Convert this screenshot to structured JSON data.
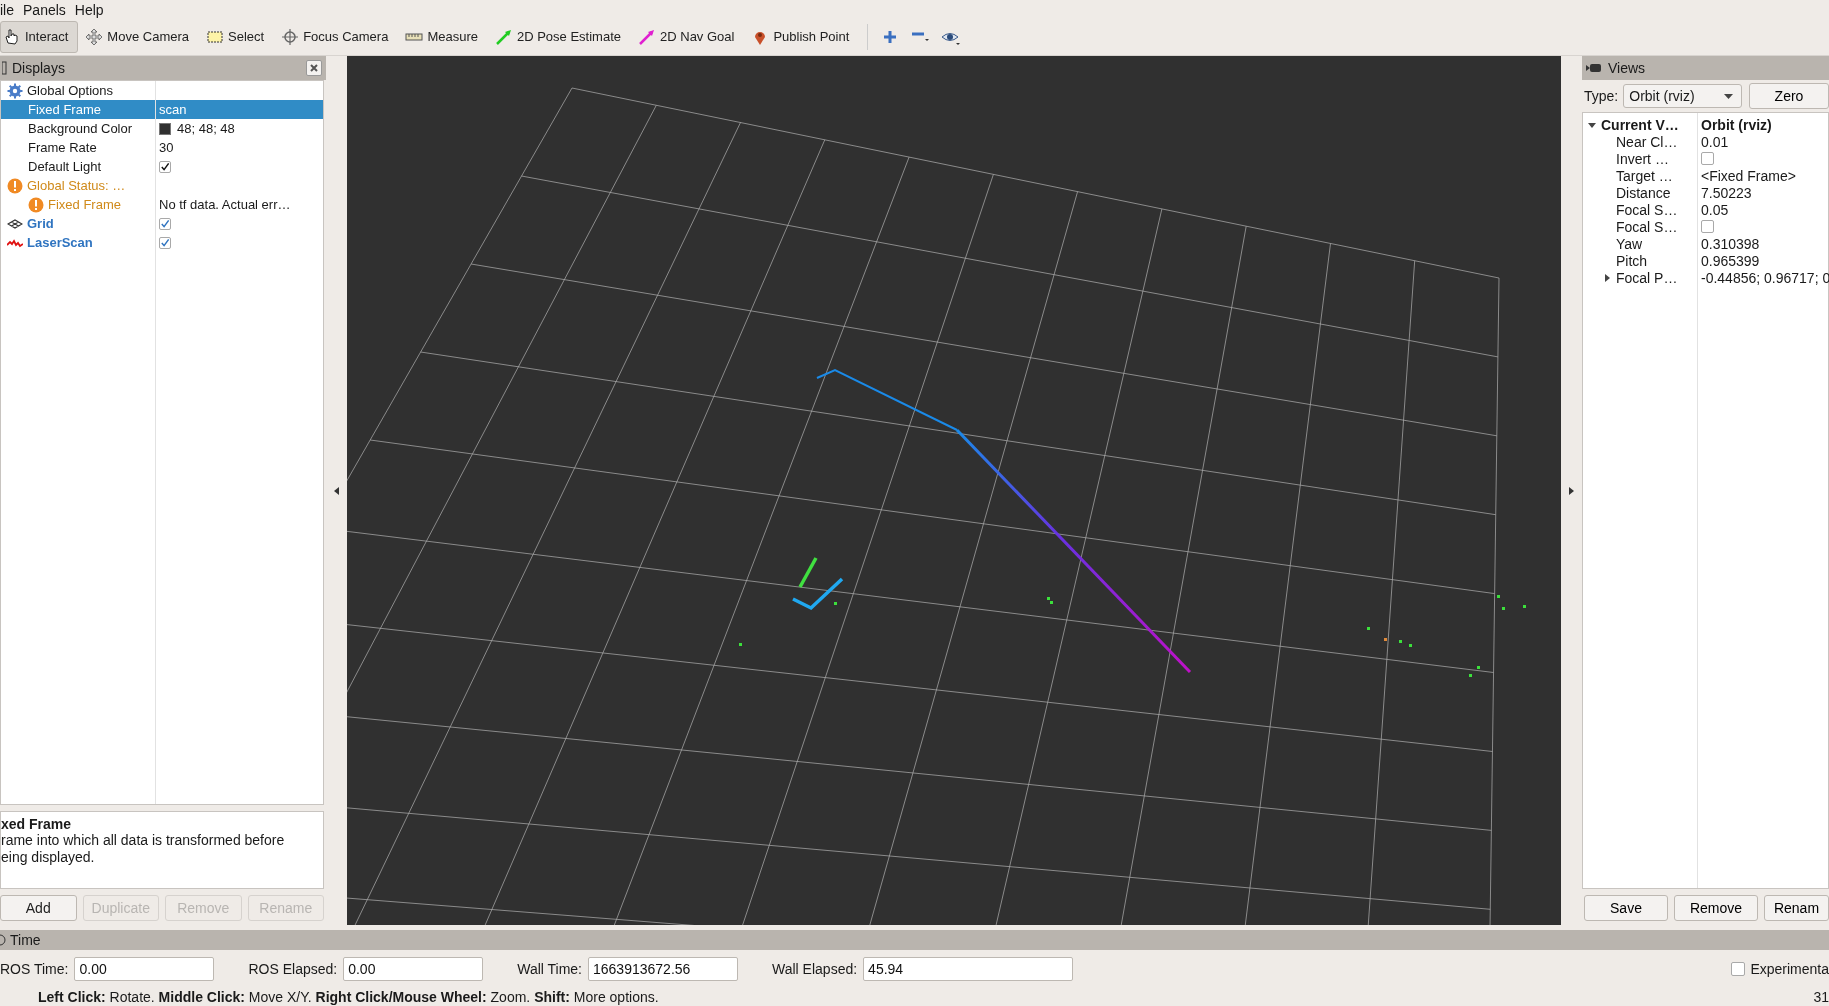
{
  "menu": [
    {
      "label": "ile"
    },
    {
      "label": "Panels"
    },
    {
      "label": "Help"
    }
  ],
  "toolbar": [
    {
      "kind": "interact",
      "label": "Interact",
      "selected": true
    },
    {
      "kind": "move",
      "label": "Move Camera",
      "selected": false
    },
    {
      "kind": "select",
      "label": "Select",
      "selected": false
    },
    {
      "kind": "focus",
      "label": "Focus Camera",
      "selected": false
    },
    {
      "kind": "measure",
      "label": "Measure",
      "selected": false
    },
    {
      "kind": "pose",
      "label": "2D Pose Estimate",
      "selected": false
    },
    {
      "kind": "goal",
      "label": "2D Nav Goal",
      "selected": false
    },
    {
      "kind": "point",
      "label": "Publish Point",
      "selected": false
    },
    {
      "kind": "plus",
      "selected": false
    },
    {
      "kind": "minus",
      "selected": false
    },
    {
      "kind": "eye",
      "selected": false
    }
  ],
  "displays": {
    "title": "Displays",
    "items": [
      {
        "kind": "options",
        "label": "Global Options",
        "selected": false,
        "children": [
          {
            "kind": "property",
            "label": "Fixed Frame",
            "value": "scan",
            "selected": true
          },
          {
            "kind": "property",
            "label": "Background Color",
            "value": "48; 48; 48",
            "color": "#303030",
            "selected": false
          },
          {
            "kind": "property",
            "label": "Frame Rate",
            "value": "30",
            "selected": false
          },
          {
            "kind": "property",
            "label": "Default Light",
            "checked": true,
            "selected": false
          }
        ]
      },
      {
        "kind": "warning",
        "label": "Global Status: …",
        "selected": false,
        "children": [
          {
            "kind": "warning",
            "label": "Fixed Frame",
            "value": "No tf data.  Actual err…",
            "selected": false
          }
        ]
      },
      {
        "kind": "grid",
        "label": "Grid",
        "checked": true,
        "selected": false
      },
      {
        "kind": "laser",
        "label": "LaserScan",
        "checked": true,
        "selected": false
      }
    ],
    "description": {
      "title": "xed Frame",
      "text": "rame into which all data is transformed before\neing displayed."
    },
    "buttons": [
      {
        "label": "Add",
        "disabled": false
      },
      {
        "label": "Duplicate",
        "disabled": true
      },
      {
        "label": "Remove",
        "disabled": true
      },
      {
        "label": "Rename",
        "disabled": true
      }
    ]
  },
  "views": {
    "title": "Views",
    "type_label": "Type:",
    "type_value": "Orbit (rviz)",
    "zero_button": "Zero",
    "items": [
      {
        "label": "Current V…",
        "value": "Orbit (rviz)",
        "expanded": true,
        "children": [
          {
            "label": "Near Cl…",
            "value": "0.01"
          },
          {
            "label": "Invert …",
            "checked": false
          },
          {
            "label": "Target …",
            "value": "<Fixed Frame>"
          },
          {
            "label": "Distance",
            "value": "7.50223"
          },
          {
            "label": "Focal S…",
            "value": "0.05"
          },
          {
            "label": "Focal S…",
            "checked": false
          },
          {
            "label": "Yaw",
            "value": "0.310398"
          },
          {
            "label": "Pitch",
            "value": "0.965399"
          },
          {
            "label": "Focal P…",
            "value": "-0.44856; 0.96717; 0",
            "expanded": false
          }
        ]
      }
    ],
    "buttons": [
      {
        "label": "Save"
      },
      {
        "label": "Remove"
      },
      {
        "label": "Renam"
      }
    ]
  },
  "time": {
    "title": "Time",
    "fields": [
      {
        "label": "ROS Time:",
        "value": "0.00"
      },
      {
        "label": "ROS Elapsed:",
        "value": "0.00"
      },
      {
        "label": "Wall Time:",
        "value": "1663913672.56"
      },
      {
        "label": "Wall Elapsed:",
        "value": "45.94"
      }
    ],
    "experimental": {
      "label": "Experimenta",
      "checked": false
    }
  },
  "status_bar": {
    "text": "**Left Click:** Rotate. **Middle Click:** Move X/Y. **Right Click/Mouse Wheel:** Zoom. **Shift:** More options.",
    "fps": "31"
  }
}
